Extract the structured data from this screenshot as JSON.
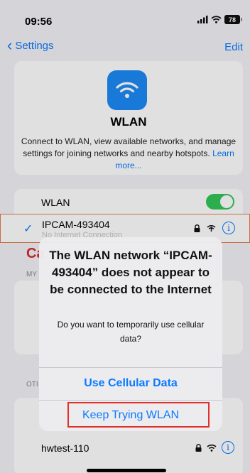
{
  "status_bar": {
    "time": "09:56",
    "battery": "78"
  },
  "nav": {
    "back_label": "Settings",
    "edit_label": "Edit"
  },
  "header": {
    "title": "WLAN",
    "description": "Connect to WLAN, view available networks, and manage settings for joining networks and nearby hotspots.",
    "learn_more": "Learn more..."
  },
  "wlan_toggle": {
    "label": "WLAN",
    "on": true
  },
  "connected_network": {
    "name": "IPCAM-493404",
    "subtitle": "No Internet Connection"
  },
  "background": {
    "red_snippet": "Ca",
    "section_my": "MY",
    "section_other": "OTI"
  },
  "networks": [
    {
      "name": "hwtest-110"
    }
  ],
  "alert": {
    "title": "The WLAN network “IPCAM-493404” does not appear to be connected to the Internet",
    "message": "Do you want to temporarily use cellular data?",
    "btn_cellular": "Use Cellular Data",
    "btn_keep": "Keep Trying WLAN"
  },
  "colors": {
    "accent": "#0a7aff",
    "toggle_on": "#34c759",
    "highlight": "#e0302b"
  },
  "icons": [
    "chevron-left-icon",
    "wifi-icon",
    "lock-icon",
    "info-icon",
    "checkmark-icon",
    "signal-icon",
    "battery-icon"
  ]
}
